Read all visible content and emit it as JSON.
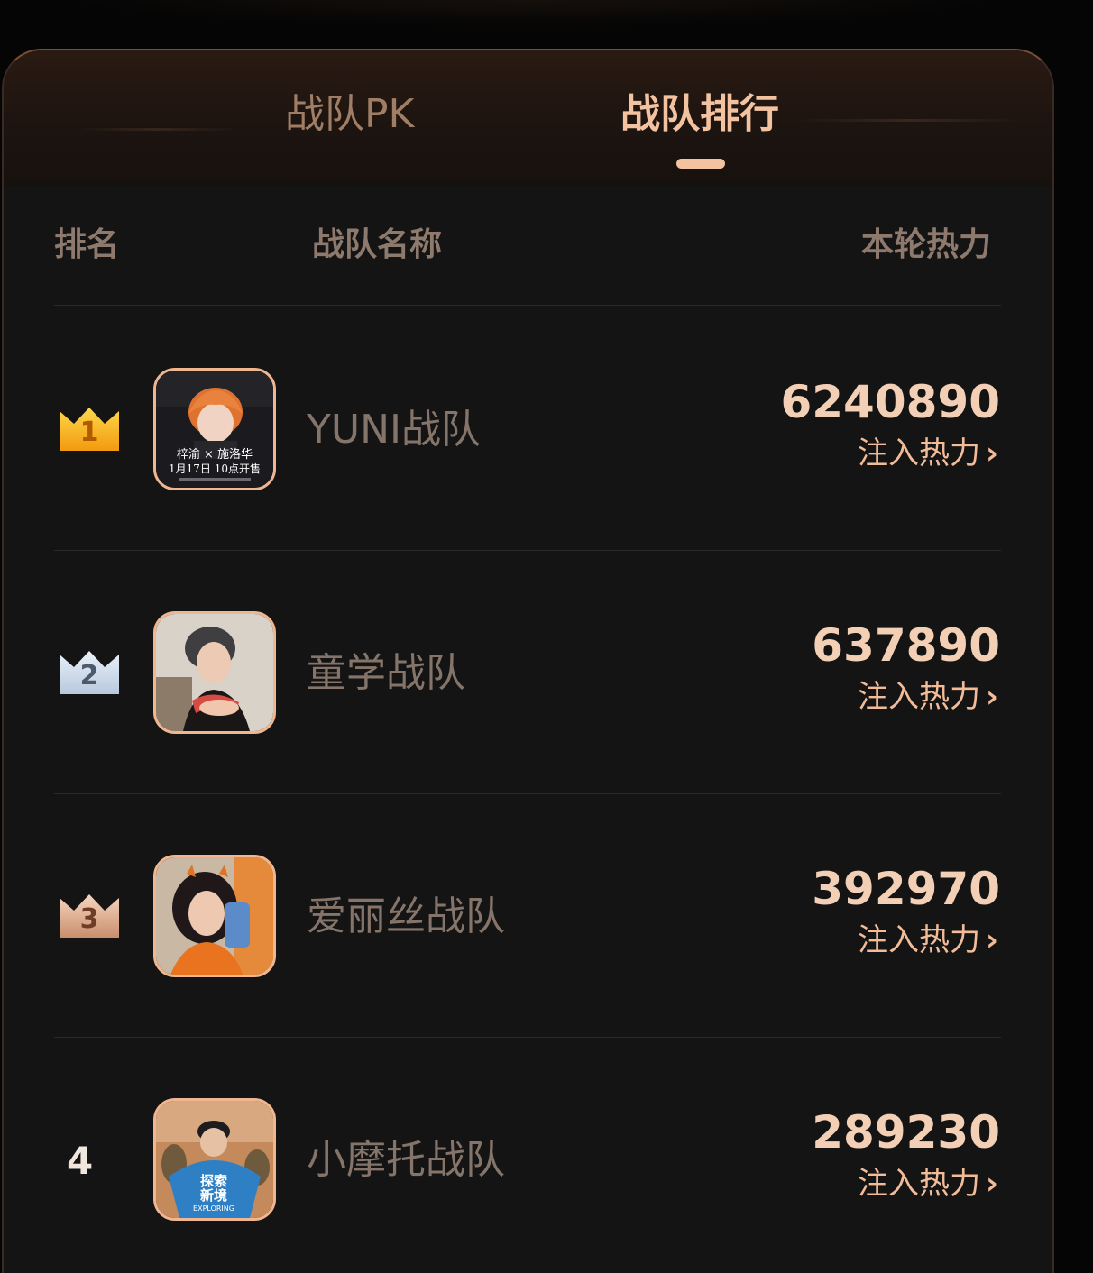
{
  "tabs": [
    {
      "label": "战队PK",
      "active": false
    },
    {
      "label": "战队排行",
      "active": true
    }
  ],
  "columns": {
    "rank": "排名",
    "name": "战队名称",
    "heat": "本轮热力"
  },
  "rows": [
    {
      "rank": "1",
      "name": "YUNI战队",
      "score": "6240890",
      "action": "注入热力",
      "crown": "gold",
      "avatar_text": [
        "梓渝 × 施洛华",
        "1月17日 10点开售"
      ]
    },
    {
      "rank": "2",
      "name": "童学战队",
      "score": "637890",
      "action": "注入热力",
      "crown": "silver"
    },
    {
      "rank": "3",
      "name": "爱丽丝战队",
      "score": "392970",
      "action": "注入热力",
      "crown": "bronze"
    },
    {
      "rank": "4",
      "name": "小摩托战队",
      "score": "289230",
      "action": "注入热力",
      "crown": "none",
      "avatar_text": [
        "探索",
        "新境",
        "EXPLORING"
      ]
    }
  ],
  "colors": {
    "accent": "#f3c3a1",
    "background": "#141414",
    "gold": "#f5b41c",
    "silver": "#c9d7e6",
    "bronze": "#d9a98a"
  },
  "icons": {
    "crown": "crown-icon",
    "chevron": "chevron-right-icon"
  }
}
